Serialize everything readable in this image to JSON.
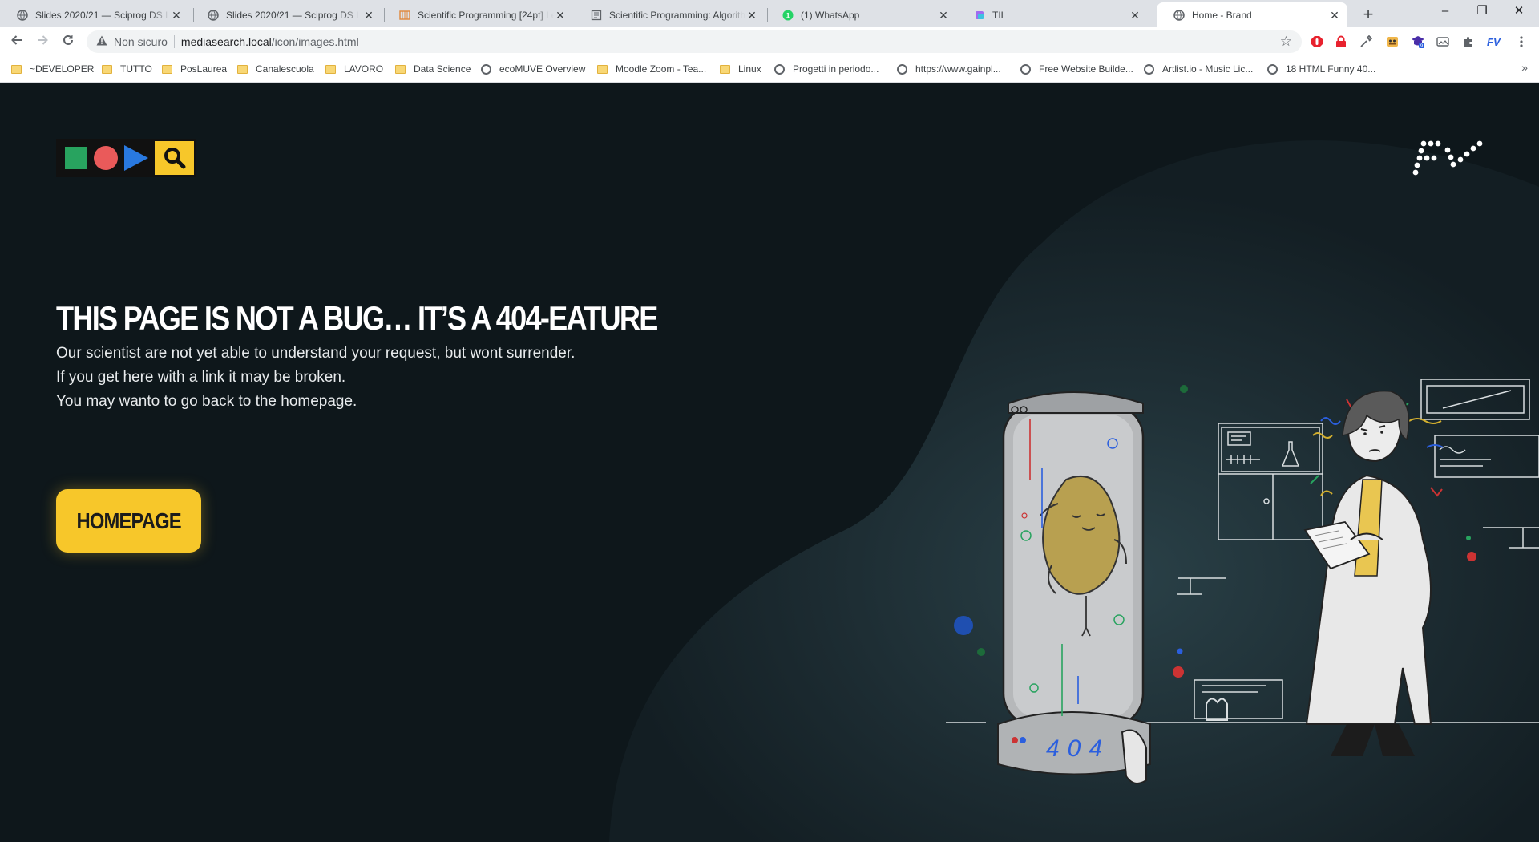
{
  "browser": {
    "tabs": [
      {
        "title": "Slides 2020/21 — Sciprog DS Lab",
        "icon": "globe-icon",
        "active": false
      },
      {
        "title": "Slides 2020/21 — Sciprog DS Lab",
        "icon": "globe-icon",
        "active": false
      },
      {
        "title": "Scientific Programming [24pt] Le",
        "icon": "book-icon",
        "active": false
      },
      {
        "title": "Scientific Programming: Algorithm",
        "icon": "document-icon",
        "active": false
      },
      {
        "title": "(1) WhatsApp",
        "icon": "whatsapp-icon",
        "active": false,
        "badge": "1"
      },
      {
        "title": "TIL",
        "icon": "cube-icon",
        "active": false
      },
      {
        "title": "Home - Brand",
        "icon": "globe-icon",
        "active": true
      }
    ],
    "new_tab_label": "+",
    "window_controls": {
      "minimize": "–",
      "maximize": "❐",
      "close": "✕"
    },
    "address": {
      "security_label": "Non sicuro",
      "url_host": "mediasearch.local",
      "url_path": "/icon/images.html"
    },
    "bookmarks": [
      {
        "label": "~DEVELOPER",
        "icon": "folder-icon"
      },
      {
        "label": "TUTTO",
        "icon": "folder-icon"
      },
      {
        "label": "PosLaurea",
        "icon": "folder-icon"
      },
      {
        "label": "Canalescuola",
        "icon": "folder-icon"
      },
      {
        "label": "LAVORO",
        "icon": "folder-icon"
      },
      {
        "label": "Data Science",
        "icon": "folder-icon"
      },
      {
        "label": "ecoMUVE Overview",
        "icon": "globe-icon"
      },
      {
        "label": "Moodle Zoom - Tea...",
        "icon": "folder-icon"
      },
      {
        "label": "Linux",
        "icon": "folder-icon"
      },
      {
        "label": "Progetti in periodo...",
        "icon": "globe-icon"
      },
      {
        "label": "https://www.gainpl...",
        "icon": "globe-icon"
      },
      {
        "label": "Free Website Builde...",
        "icon": "globe-icon"
      },
      {
        "label": "Artlist.io - Music Lic...",
        "icon": "globe-icon"
      },
      {
        "label": "18 HTML Funny 40...",
        "icon": "globe-icon"
      }
    ],
    "bookmarks_overflow": "»"
  },
  "page": {
    "headline": "THIS PAGE IS NOT A BUG… IT’S A 404-EATURE",
    "message_lines": [
      "Our scientist are not yet able to understand your request, but wont surrender.",
      "If you get here with a link it may be broken.",
      "You may wanto to go back to the homepage."
    ],
    "home_button": "HOMEPAGE",
    "tube_text": "404",
    "brand_mark": "FV",
    "colors": {
      "background": "#0e171b",
      "accent_yellow": "#f7c72a",
      "logo_green": "#28a35f",
      "logo_red": "#ea5a5a",
      "logo_blue": "#2979e0"
    }
  }
}
